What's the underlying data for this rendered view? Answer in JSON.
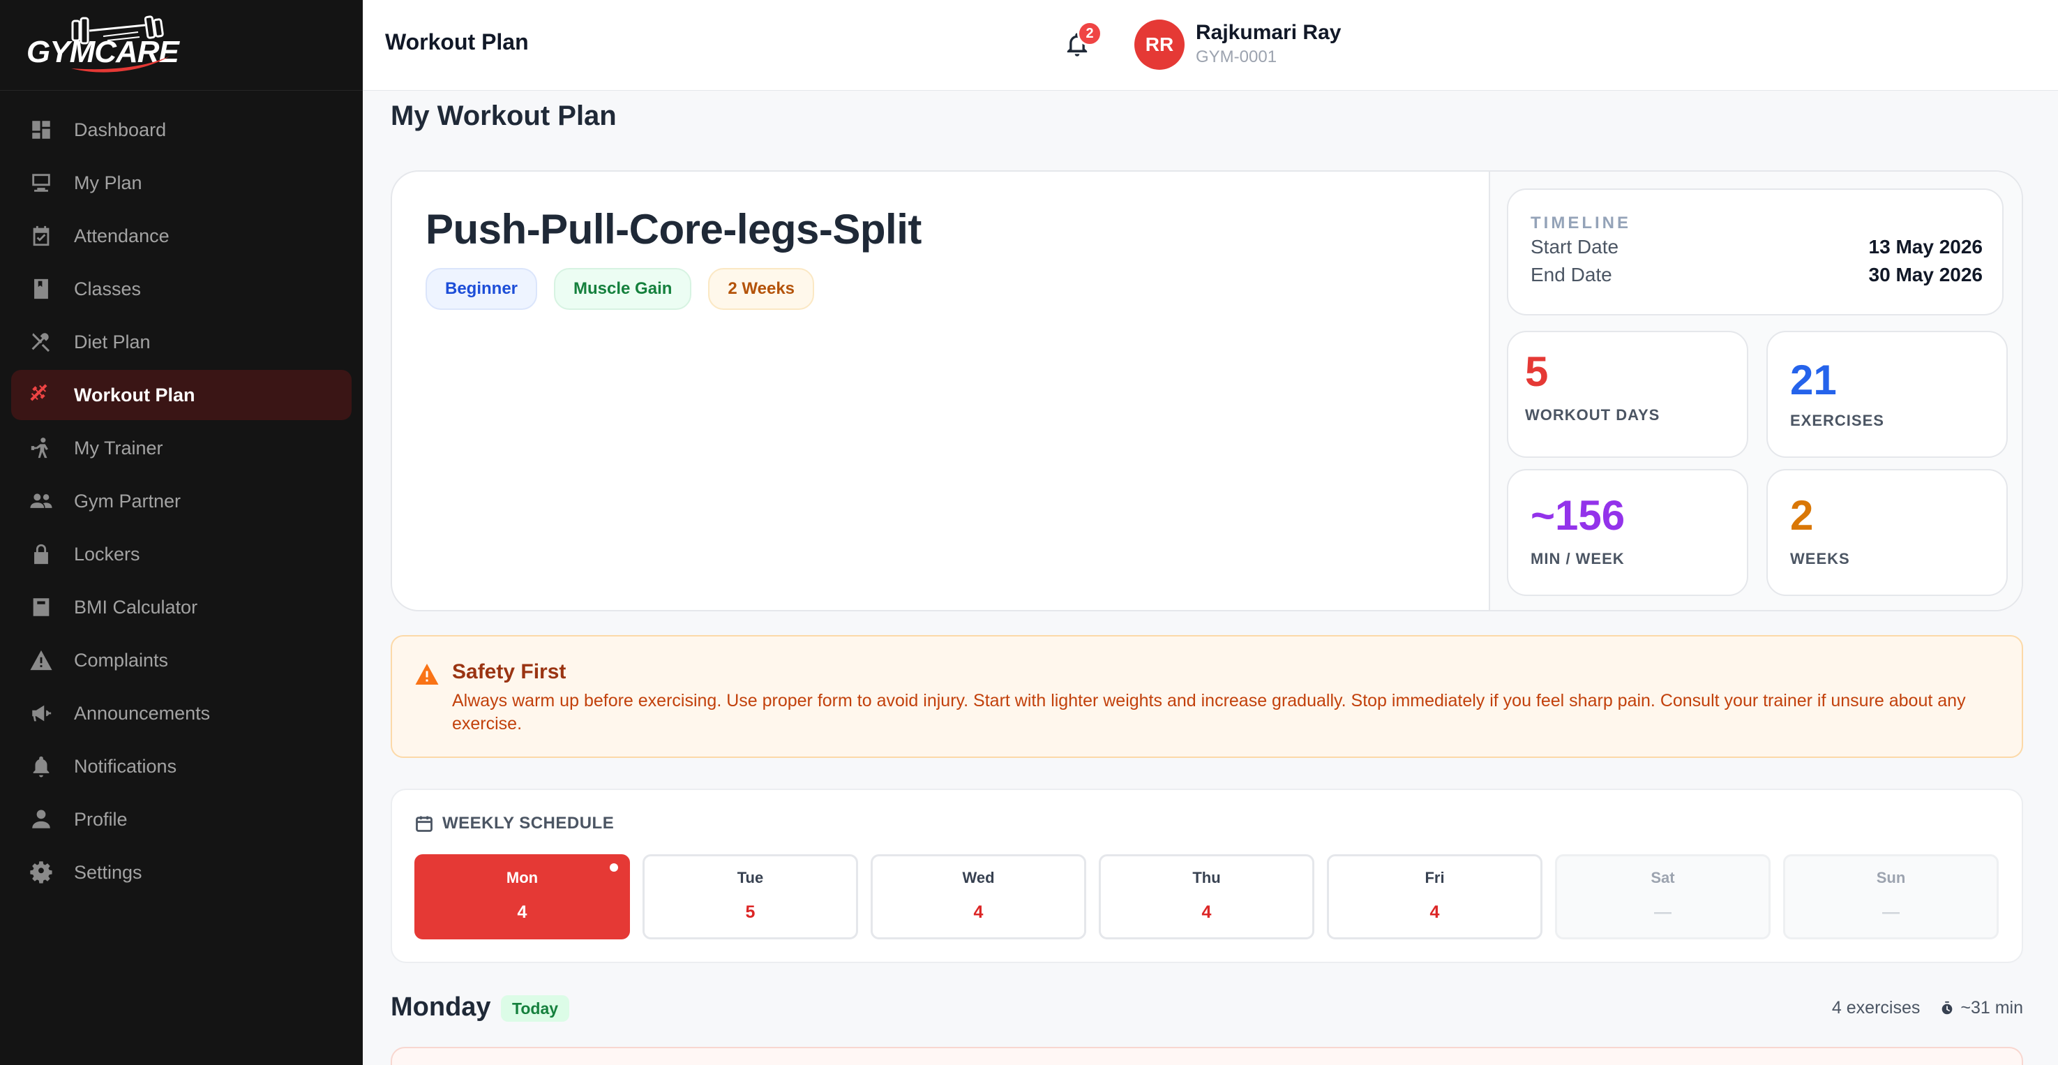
{
  "brand": {
    "name": "GYMCARE",
    "accent": "#e53935",
    "sidebar_bg": "#141414"
  },
  "sidebar": {
    "items": [
      {
        "label": "Dashboard",
        "icon": "dashboard-icon"
      },
      {
        "label": "My Plan",
        "icon": "plan-icon"
      },
      {
        "label": "Attendance",
        "icon": "calendar-check-icon"
      },
      {
        "label": "Classes",
        "icon": "book-icon"
      },
      {
        "label": "Diet Plan",
        "icon": "utensils-icon"
      },
      {
        "label": "Workout Plan",
        "icon": "dumbbell-icon",
        "active": true
      },
      {
        "label": "My Trainer",
        "icon": "trainer-icon"
      },
      {
        "label": "Gym Partner",
        "icon": "people-icon"
      },
      {
        "label": "Lockers",
        "icon": "lock-icon"
      },
      {
        "label": "BMI Calculator",
        "icon": "calculator-icon"
      },
      {
        "label": "Complaints",
        "icon": "warning-icon"
      },
      {
        "label": "Announcements",
        "icon": "megaphone-icon"
      },
      {
        "label": "Notifications",
        "icon": "bell-icon"
      },
      {
        "label": "Profile",
        "icon": "person-icon"
      },
      {
        "label": "Settings",
        "icon": "gear-icon"
      }
    ]
  },
  "topbar": {
    "title": "Workout Plan",
    "notification_count": "2",
    "user": {
      "initials": "RR",
      "name": "Rajkumari Ray",
      "id": "GYM-0001"
    }
  },
  "page": {
    "title": "My Workout Plan"
  },
  "plan": {
    "name": "Push-Pull-Core-legs-Split",
    "tags": [
      "Beginner",
      "Muscle Gain",
      "2 Weeks"
    ],
    "timeline": {
      "label": "TIMELINE",
      "start_label": "Start Date",
      "start_value": "13 May 2026",
      "end_label": "End Date",
      "end_value": "30 May 2026"
    },
    "stats": [
      {
        "value": "5",
        "label": "WORKOUT DAYS",
        "color": "#e53935"
      },
      {
        "value": "21",
        "label": "EXERCISES",
        "color": "#2563eb"
      },
      {
        "value": "~156",
        "label": "MIN / WEEK",
        "color": "#9333ea"
      },
      {
        "value": "2",
        "label": "WEEKS",
        "color": "#d97706"
      }
    ]
  },
  "safety": {
    "title": "Safety First",
    "text": "Always warm up before exercising. Use proper form to avoid injury. Start with lighter weights and increase gradually. Stop immediately if you feel sharp pain. Consult your trainer if unsure about any exercise."
  },
  "schedule": {
    "title": "WEEKLY SCHEDULE",
    "days": [
      {
        "name": "Mon",
        "count": "4",
        "state": "active"
      },
      {
        "name": "Tue",
        "count": "5",
        "state": "workout"
      },
      {
        "name": "Wed",
        "count": "4",
        "state": "workout"
      },
      {
        "name": "Thu",
        "count": "4",
        "state": "workout"
      },
      {
        "name": "Fri",
        "count": "4",
        "state": "workout"
      },
      {
        "name": "Sat",
        "count": "—",
        "state": "rest"
      },
      {
        "name": "Sun",
        "count": "—",
        "state": "rest"
      }
    ]
  },
  "day_detail": {
    "title": "Monday",
    "badge": "Today",
    "exercises": "4 exercises",
    "duration": "~31 min"
  }
}
